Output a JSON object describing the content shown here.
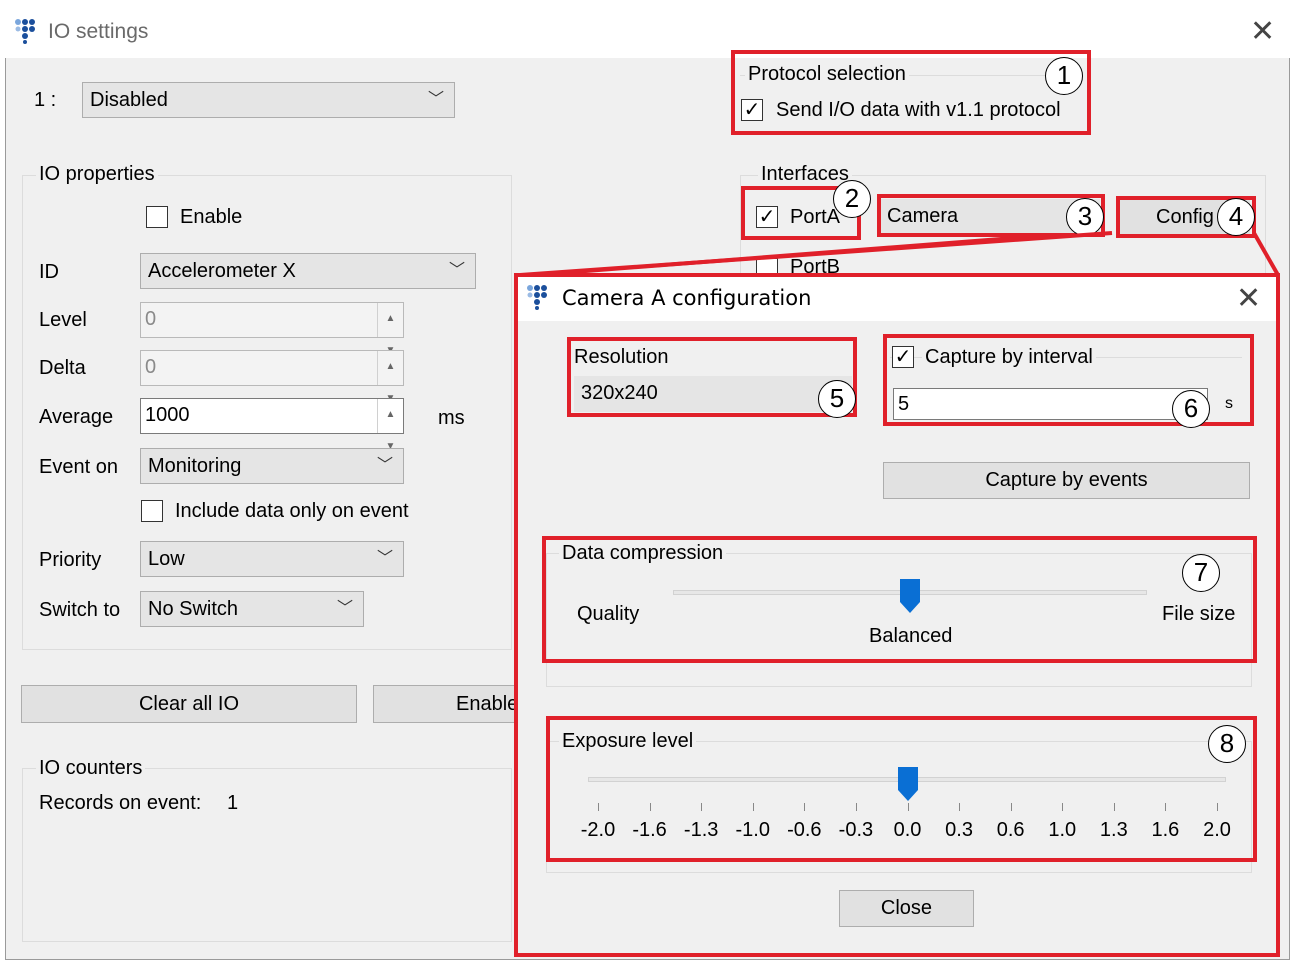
{
  "window": {
    "title": "IO settings"
  },
  "io_select": {
    "index_label": "1 :",
    "value": "Disabled"
  },
  "io_properties": {
    "title": "IO properties",
    "enable_label": "Enable",
    "id_label": "ID",
    "id_value": "Accelerometer X",
    "level_label": "Level",
    "level_value": "0",
    "delta_label": "Delta",
    "delta_value": "0",
    "average_label": "Average",
    "average_value": "1000",
    "average_unit": "ms",
    "event_on_label": "Event on",
    "event_on_value": "Monitoring",
    "include_label": "Include data only on event",
    "priority_label": "Priority",
    "priority_value": "Low",
    "switch_to_label": "Switch to",
    "switch_to_value": "No Switch"
  },
  "buttons": {
    "clear_all": "Clear all IO",
    "enable": "Enable"
  },
  "io_counters": {
    "title": "IO counters",
    "records_label": "Records on event:",
    "records_value": "1"
  },
  "protocol": {
    "title": "Protocol selection",
    "send_label": "Send I/O data with v1.1 protocol",
    "checked": true
  },
  "interfaces": {
    "title": "Interfaces",
    "porta_label": "PortA",
    "porta_checked": true,
    "device_value": "Camera",
    "config_label": "Config",
    "portb_label": "PortB"
  },
  "callouts": [
    "1",
    "2",
    "3",
    "4",
    "5",
    "6",
    "7",
    "8"
  ],
  "dialog": {
    "title": "Camera A configuration",
    "resolution_label": "Resolution",
    "resolution_value": "320x240",
    "capture_interval_label": "Capture by interval",
    "capture_interval_checked": true,
    "interval_value": "5",
    "interval_unit": "s",
    "capture_events_label": "Capture by events",
    "compression": {
      "title": "Data compression",
      "left_label": "Quality",
      "right_label": "File size",
      "value_label": "Balanced",
      "position": 0.5
    },
    "exposure": {
      "title": "Exposure level",
      "ticks": [
        "-2.0",
        "-1.6",
        "-1.3",
        "-1.0",
        "-0.6",
        "-0.3",
        "0.0",
        "0.3",
        "0.6",
        "1.0",
        "1.3",
        "1.6",
        "2.0"
      ],
      "value": 0.0
    },
    "close_label": "Close"
  },
  "colors": {
    "callout_red": "#e0202a",
    "slider_blue": "#0a6fd4",
    "logo_blue": "#1b4f9c"
  }
}
